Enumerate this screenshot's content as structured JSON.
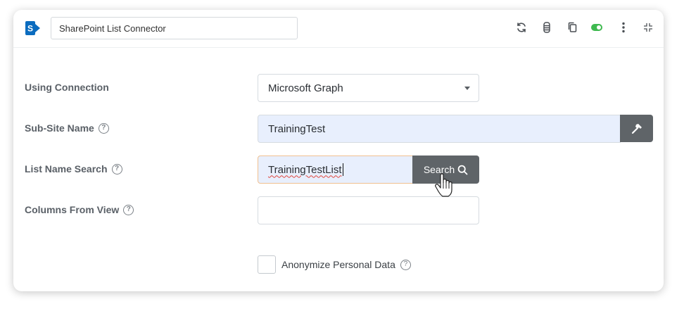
{
  "header": {
    "title_value": "SharePoint List Connector",
    "logo_letter": "S",
    "icons": [
      "refresh-icon",
      "database-icon",
      "copy-icon",
      "toggle-on-icon",
      "more-vertical-icon",
      "collapse-icon"
    ],
    "toggle_color": "#3fb950"
  },
  "form": {
    "connection": {
      "label": "Using Connection",
      "value": "Microsoft Graph"
    },
    "subsite": {
      "label": "Sub-Site Name",
      "value": "TrainingTest"
    },
    "list_search": {
      "label": "List Name Search",
      "value": "TrainingTestList",
      "button_label": "Search"
    },
    "columns": {
      "label": "Columns From View",
      "value": ""
    },
    "anonymize": {
      "label": "Anonymize Personal Data",
      "checked": false
    },
    "help_glyph": "?"
  },
  "colors": {
    "accent_button": "#5f6468",
    "filled_field": "#e8effd",
    "sharepoint_blue": "#0b6cbf"
  }
}
